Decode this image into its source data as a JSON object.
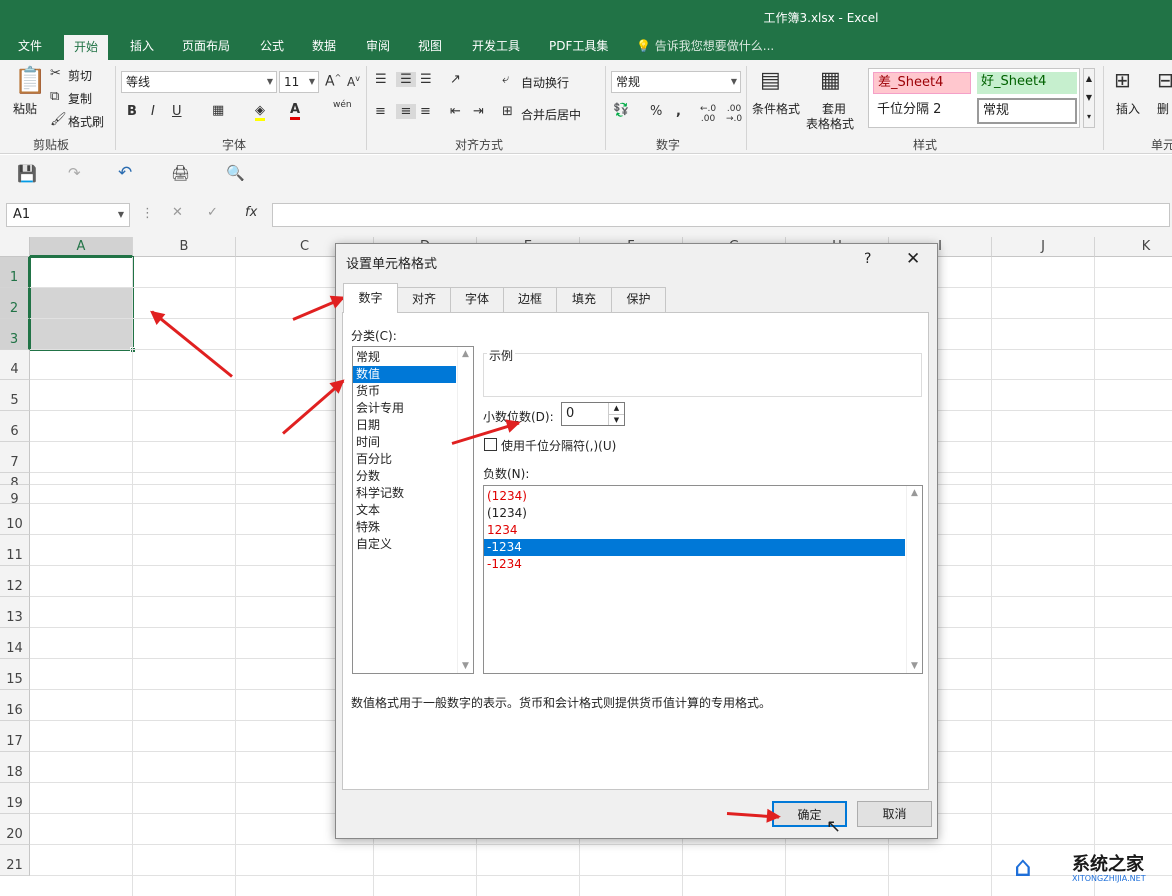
{
  "window": {
    "title": "工作簿3.xlsx - Excel"
  },
  "ribbon_tabs": [
    "文件",
    "开始",
    "插入",
    "页面布局",
    "公式",
    "数据",
    "审阅",
    "视图",
    "开发工具",
    "PDF工具集"
  ],
  "tell_me": "告诉我您想要做什么...",
  "clipboard": {
    "paste": "粘贴",
    "cut": "剪切",
    "copy": "复制",
    "format_painter": "格式刷",
    "label": "剪贴板"
  },
  "font": {
    "name": "等线",
    "size": "11",
    "bold": "B",
    "italic": "I",
    "underline": "U",
    "grow": "A",
    "shrink": "A",
    "phonetic": "wén",
    "label": "字体"
  },
  "alignment": {
    "wrap_text": "自动换行",
    "merge_center": "合并后居中",
    "label": "对齐方式"
  },
  "number": {
    "format": "常规",
    "percent": "%",
    "comma": ",",
    "label": "数字"
  },
  "styles": {
    "conditional": "条件格式",
    "table_format_1": "套用",
    "table_format_2": "表格格式",
    "bad": "差_Sheet4",
    "good": "好_Sheet4",
    "thousands": "千位分隔 2",
    "normal": "常规",
    "label": "样式"
  },
  "cells": {
    "insert": "插入",
    "delete": "删",
    "label": "单元"
  },
  "name_box": "A1",
  "fx": "fx",
  "columns": [
    "A",
    "B",
    "C",
    "D",
    "E",
    "F",
    "G",
    "H",
    "I",
    "J",
    "K"
  ],
  "rows": [
    "1",
    "2",
    "3",
    "4",
    "5",
    "6",
    "7",
    "8",
    "9",
    "10",
    "11",
    "12",
    "13",
    "14",
    "15",
    "16",
    "17",
    "18",
    "19",
    "20",
    "21"
  ],
  "dialog": {
    "title": "设置单元格格式",
    "help": "?",
    "close": "✕",
    "tabs": [
      "数字",
      "对齐",
      "字体",
      "边框",
      "填充",
      "保护"
    ],
    "category_label": "分类(C):",
    "categories": [
      "常规",
      "数值",
      "货币",
      "会计专用",
      "日期",
      "时间",
      "百分比",
      "分数",
      "科学记数",
      "文本",
      "特殊",
      "自定义"
    ],
    "selected_category": "数值",
    "sample_label": "示例",
    "decimal_label": "小数位数(D):",
    "decimal_value": "0",
    "thousands_label": "使用千位分隔符(,)(U)",
    "negative_label": "负数(N):",
    "negatives": [
      "(1234)",
      "(1234)",
      "1234",
      "-1234",
      "-1234"
    ],
    "description": "数值格式用于一般数字的表示。货币和会计格式则提供货币值计算的专用格式。",
    "ok": "确定",
    "cancel": "取消"
  },
  "watermark": {
    "name": "系统之家",
    "url": "XITONGZHIJIA.NET"
  },
  "colors": {
    "excel_green": "#217346",
    "selection_blue": "#0078d7",
    "annotation_red": "#e02020"
  }
}
